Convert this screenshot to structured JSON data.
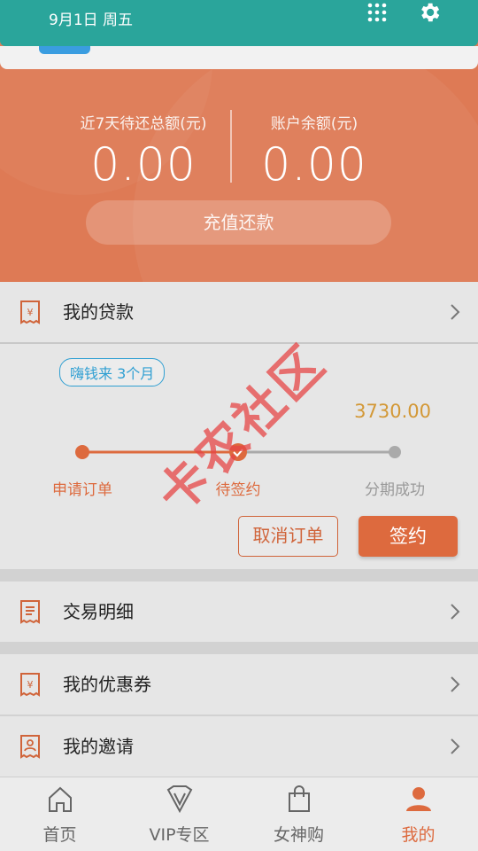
{
  "status": {
    "date": "9月1日 周五"
  },
  "hero": {
    "left_label": "近7天待还总额(元)",
    "left_value": "0.00",
    "right_label": "账户余额(元)",
    "right_value": "0.00",
    "recharge_label": "充值还款"
  },
  "menu": {
    "loans": "我的贷款",
    "transactions": "交易明细",
    "coupons": "我的优惠券",
    "invites": "我的邀请"
  },
  "loan": {
    "tag": "嗨钱来 3个月",
    "amount": "3730.00",
    "steps": [
      "申请订单",
      "待签约",
      "分期成功"
    ],
    "cancel_label": "取消订单",
    "sign_label": "签约"
  },
  "tabs": [
    {
      "label": "首页",
      "icon": "home-icon"
    },
    {
      "label": "VIP专区",
      "icon": "vip-icon"
    },
    {
      "label": "女神购",
      "icon": "shopping-bag-icon"
    },
    {
      "label": "我的",
      "icon": "user-icon"
    }
  ],
  "watermark": "卡农社区",
  "colors": {
    "accent": "#dd6a3e",
    "teal": "#2aa59b",
    "amount": "#d39836",
    "tag": "#2f9fd2"
  }
}
